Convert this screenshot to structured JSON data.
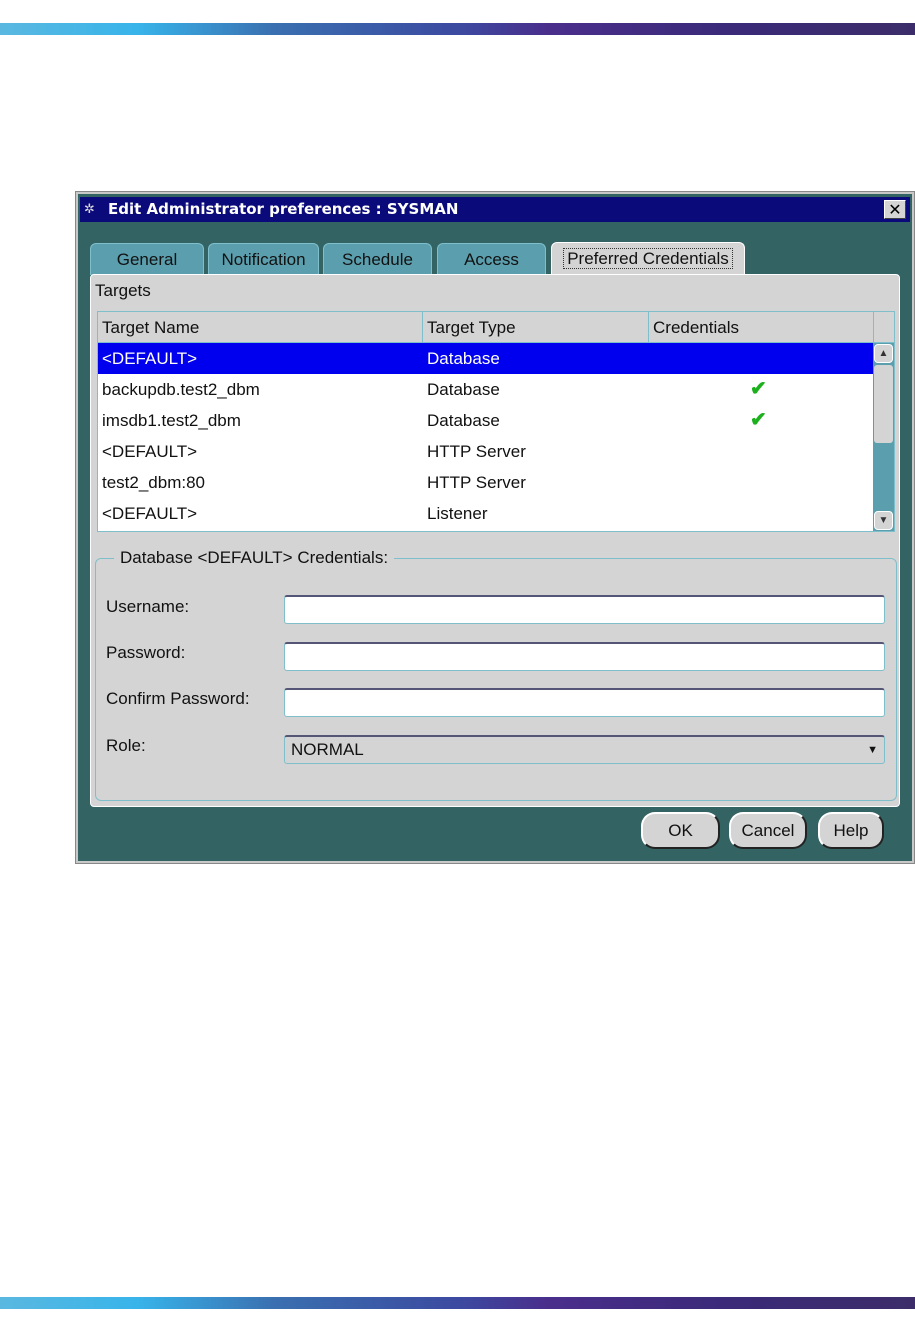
{
  "dialog": {
    "title": "Edit Administrator preferences : SYSMAN"
  },
  "tabs": [
    "General",
    "Notification",
    "Schedule",
    "Access",
    "Preferred Credentials"
  ],
  "targets_label": "Targets",
  "table": {
    "columns": [
      "Target Name",
      "Target Type",
      "Credentials"
    ],
    "rows": [
      {
        "name": "<DEFAULT>",
        "type": "Database",
        "cred": ""
      },
      {
        "name": "backupdb.test2_dbm",
        "type": "Database",
        "cred": "✔"
      },
      {
        "name": "imsdb1.test2_dbm",
        "type": "Database",
        "cred": "✔"
      },
      {
        "name": "<DEFAULT>",
        "type": "HTTP Server",
        "cred": ""
      },
      {
        "name": "test2_dbm:80",
        "type": "HTTP Server",
        "cred": ""
      },
      {
        "name": "<DEFAULT>",
        "type": "Listener",
        "cred": ""
      }
    ]
  },
  "credentials": {
    "legend": "Database <DEFAULT> Credentials:",
    "username_label": "Username:",
    "username": "",
    "password_label": "Password:",
    "password": "",
    "confirm_label": "Confirm Password:",
    "confirm": "",
    "role_label": "Role:",
    "role": "NORMAL"
  },
  "buttons": {
    "ok": "OK",
    "cancel": "Cancel",
    "help": "Help"
  }
}
